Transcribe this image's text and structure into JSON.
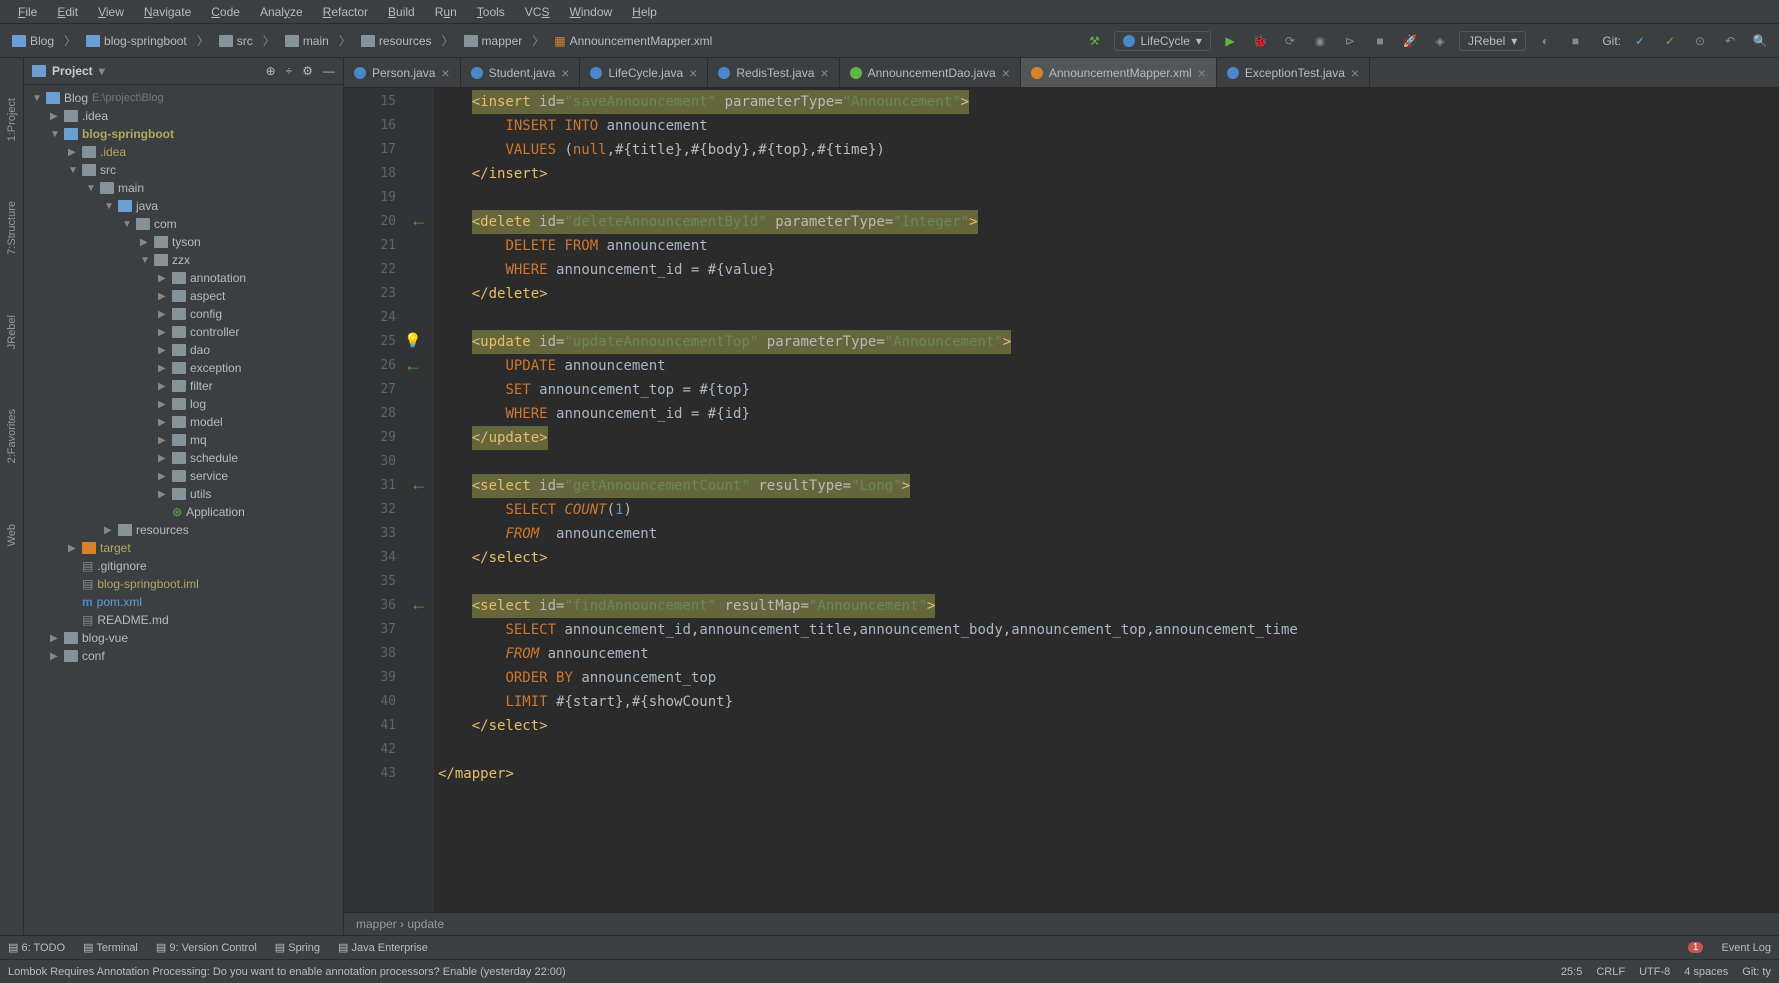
{
  "menu": [
    "File",
    "Edit",
    "View",
    "Navigate",
    "Code",
    "Analyze",
    "Refactor",
    "Build",
    "Run",
    "Tools",
    "VCS",
    "Window",
    "Help"
  ],
  "menuAccel": [
    0,
    0,
    0,
    0,
    0,
    4,
    0,
    0,
    1,
    0,
    2,
    0,
    0
  ],
  "breadcrumbs": [
    {
      "label": "Blog",
      "type": "folder-blue"
    },
    {
      "label": "blog-springboot",
      "type": "folder-blue"
    },
    {
      "label": "src",
      "type": "folder"
    },
    {
      "label": "main",
      "type": "folder"
    },
    {
      "label": "resources",
      "type": "folder"
    },
    {
      "label": "mapper",
      "type": "folder"
    },
    {
      "label": "AnnouncementMapper.xml",
      "type": "xml"
    }
  ],
  "runConfig": "LifeCycle",
  "jrebel": "JRebel",
  "gitLabel": "Git:",
  "projectPanel": {
    "title": "Project",
    "tree": [
      {
        "d": 0,
        "arrow": "▼",
        "icon": "folder-blue",
        "label": "Blog",
        "path": "E:\\project\\Blog",
        "hl": false
      },
      {
        "d": 1,
        "arrow": "▶",
        "icon": "folder",
        "label": ".idea",
        "hl": false
      },
      {
        "d": 1,
        "arrow": "▼",
        "icon": "folder-blue",
        "label": "blog-springboot",
        "hl": true,
        "bold": true
      },
      {
        "d": 2,
        "arrow": "▶",
        "icon": "folder",
        "label": ".idea",
        "hl": true
      },
      {
        "d": 2,
        "arrow": "▼",
        "icon": "folder",
        "label": "src",
        "hl": false
      },
      {
        "d": 3,
        "arrow": "▼",
        "icon": "folder",
        "label": "main",
        "hl": false
      },
      {
        "d": 4,
        "arrow": "▼",
        "icon": "folder-blue",
        "label": "java",
        "hl": false
      },
      {
        "d": 5,
        "arrow": "▼",
        "icon": "folder",
        "label": "com",
        "hl": false
      },
      {
        "d": 6,
        "arrow": "▶",
        "icon": "folder",
        "label": "tyson",
        "hl": false
      },
      {
        "d": 6,
        "arrow": "▼",
        "icon": "folder",
        "label": "zzx",
        "hl": false
      },
      {
        "d": 7,
        "arrow": "▶",
        "icon": "folder",
        "label": "annotation",
        "hl": false
      },
      {
        "d": 7,
        "arrow": "▶",
        "icon": "folder",
        "label": "aspect",
        "hl": false
      },
      {
        "d": 7,
        "arrow": "▶",
        "icon": "folder",
        "label": "config",
        "hl": false
      },
      {
        "d": 7,
        "arrow": "▶",
        "icon": "folder",
        "label": "controller",
        "hl": false
      },
      {
        "d": 7,
        "arrow": "▶",
        "icon": "folder",
        "label": "dao",
        "hl": false
      },
      {
        "d": 7,
        "arrow": "▶",
        "icon": "folder",
        "label": "exception",
        "hl": false
      },
      {
        "d": 7,
        "arrow": "▶",
        "icon": "folder",
        "label": "filter",
        "hl": false
      },
      {
        "d": 7,
        "arrow": "▶",
        "icon": "folder",
        "label": "log",
        "hl": false
      },
      {
        "d": 7,
        "arrow": "▶",
        "icon": "folder",
        "label": "model",
        "hl": false
      },
      {
        "d": 7,
        "arrow": "▶",
        "icon": "folder",
        "label": "mq",
        "hl": false
      },
      {
        "d": 7,
        "arrow": "▶",
        "icon": "folder",
        "label": "schedule",
        "hl": false
      },
      {
        "d": 7,
        "arrow": "▶",
        "icon": "folder",
        "label": "service",
        "hl": false
      },
      {
        "d": 7,
        "arrow": "▶",
        "icon": "folder",
        "label": "utils",
        "hl": false
      },
      {
        "d": 7,
        "arrow": "",
        "icon": "app",
        "label": "Application",
        "hl": false
      },
      {
        "d": 4,
        "arrow": "▶",
        "icon": "folder",
        "label": "resources",
        "hl": false
      },
      {
        "d": 2,
        "arrow": "▶",
        "icon": "folder-orange",
        "label": "target",
        "hl": true
      },
      {
        "d": 2,
        "arrow": "",
        "icon": "file",
        "label": ".gitignore",
        "hl": false
      },
      {
        "d": 2,
        "arrow": "",
        "icon": "file",
        "label": "blog-springboot.iml",
        "hl": true
      },
      {
        "d": 2,
        "arrow": "",
        "icon": "maven",
        "label": "pom.xml",
        "hl": false,
        "mod": true
      },
      {
        "d": 2,
        "arrow": "",
        "icon": "file",
        "label": "README.md",
        "hl": false
      },
      {
        "d": 1,
        "arrow": "▶",
        "icon": "folder",
        "label": "blog-vue",
        "hl": false
      },
      {
        "d": 1,
        "arrow": "▶",
        "icon": "folder",
        "label": "conf",
        "hl": false
      }
    ]
  },
  "tabs": [
    {
      "icon": "b",
      "label": "Person.java"
    },
    {
      "icon": "b",
      "label": "Student.java"
    },
    {
      "icon": "b",
      "label": "LifeCycle.java"
    },
    {
      "icon": "b",
      "label": "RedisTest.java"
    },
    {
      "icon": "g",
      "label": "AnnouncementDao.java"
    },
    {
      "icon": "o",
      "label": "AnnouncementMapper.xml",
      "active": true
    },
    {
      "icon": "b",
      "label": "ExceptionTest.java"
    }
  ],
  "lineStart": 15,
  "lineCount": 29,
  "editorCrumbs": "mapper  ›  update",
  "leftRail": [
    "1:Project",
    "7:Structure",
    "JRebel",
    "2:Favorites",
    "Web"
  ],
  "bottomTabs": [
    "6: TODO",
    "Terminal",
    "9: Version Control",
    "Spring",
    "Java Enterprise"
  ],
  "eventLog": "Event Log",
  "eventCount": "1",
  "statusMsg": "Lombok Requires Annotation Processing: Do you want to enable annotation processors? Enable (yesterday 22:00)",
  "statusRight": {
    "pos": "25:5",
    "eol": "CRLF",
    "charset": "UTF-8",
    "indent": "4 spaces",
    "git": "Git: ty"
  }
}
